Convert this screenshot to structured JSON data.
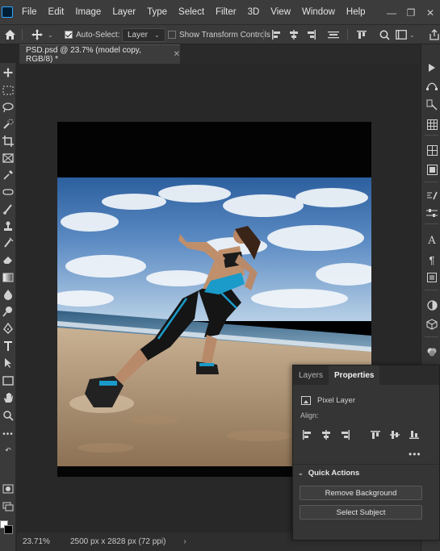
{
  "menubar": {
    "items": [
      "File",
      "Edit",
      "Image",
      "Layer",
      "Type",
      "Select",
      "Filter",
      "3D",
      "View",
      "Window",
      "Help"
    ],
    "window_controls": [
      "minimize",
      "restore",
      "close"
    ]
  },
  "options": {
    "auto_select_label": "Auto-Select:",
    "auto_select_checked": true,
    "layer_dropdown": "Layer",
    "show_transform_label": "Show Transform Controls",
    "show_transform_checked": false
  },
  "document": {
    "tab_title": "PSD.psd @ 23.7% (model copy, RGB/8) *"
  },
  "status": {
    "zoom": "23.71%",
    "doc_info": "2500 px x 2828 px (72 ppi)"
  },
  "panel": {
    "tabs": [
      "Layers",
      "Properties"
    ],
    "active_tab": "Properties",
    "layer_type": "Pixel Layer",
    "align_label": "Align:",
    "quick_actions_label": "Quick Actions",
    "buttons": [
      "Remove Background",
      "Select Subject"
    ]
  },
  "colors": {
    "foreground": "#ffffff",
    "background": "#000000",
    "accent": "#31a8ff"
  }
}
